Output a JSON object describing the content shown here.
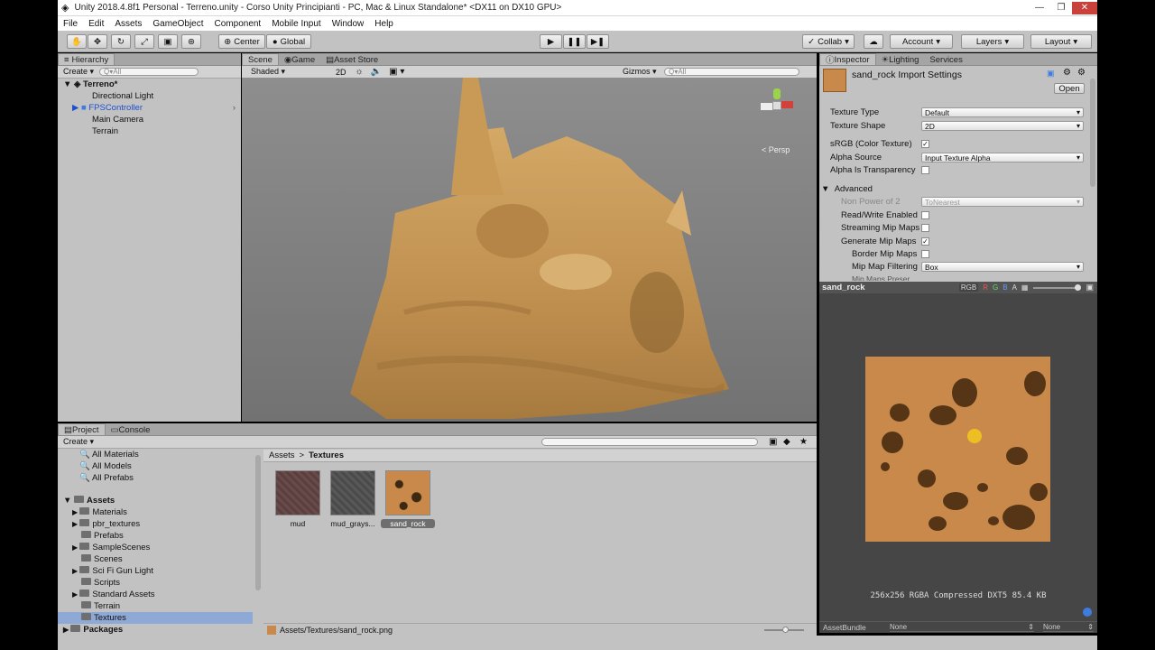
{
  "window": {
    "title": "Unity 2018.4.8f1 Personal - Terreno.unity - Corso Unity Principianti - PC, Mac & Linux Standalone* <DX11 on DX10 GPU>"
  },
  "menu": [
    "File",
    "Edit",
    "Assets",
    "GameObject",
    "Component",
    "Mobile Input",
    "Window",
    "Help"
  ],
  "toolbar": {
    "center_label": "Center",
    "global_label": "Global",
    "collab_label": "Collab",
    "account_label": "Account",
    "layers_label": "Layers",
    "layout_label": "Layout"
  },
  "hierarchy": {
    "tab": "Hierarchy",
    "create": "Create",
    "search_placeholder": "Q▾All",
    "scene": "Terreno*",
    "items": [
      "Directional Light",
      "FPSController",
      "Main Camera",
      "Terrain"
    ]
  },
  "scene_view": {
    "tabs": [
      "Scene",
      "Game",
      "Asset Store"
    ],
    "shading": "Shaded",
    "mode_2d": "2D",
    "gizmos": "Gizmos",
    "search_placeholder": "Q▾All",
    "persp": "< Persp"
  },
  "inspector": {
    "tabs": [
      "Inspector",
      "Lighting",
      "Services"
    ],
    "asset_title": "sand_rock Import Settings",
    "open_label": "Open",
    "texture_type_label": "Texture Type",
    "texture_type_value": "Default",
    "texture_shape_label": "Texture Shape",
    "texture_shape_value": "2D",
    "srgb_label": "sRGB (Color Texture)",
    "alpha_source_label": "Alpha Source",
    "alpha_source_value": "Input Texture Alpha",
    "alpha_transparency_label": "Alpha Is Transparency",
    "advanced_label": "Advanced",
    "npot_label": "Non Power of 2",
    "npot_value": "ToNearest",
    "readwrite_label": "Read/Write Enabled",
    "streaming_label": "Streaming Mip Maps",
    "genmip_label": "Generate Mip Maps",
    "bordermip_label": "Border Mip Maps",
    "mipfilter_label": "Mip Map Filtering",
    "mipfilter_value": "Box",
    "cutoff_label": "Mip Maps Preser..."
  },
  "preview": {
    "name": "sand_rock",
    "channels": [
      "RGB",
      "R",
      "G",
      "B",
      "A"
    ],
    "info": "256x256  RGBA Compressed DXT5   85.4 KB",
    "assetbundle_label": "AssetBundle",
    "assetbundle_value": "None",
    "variant_value": "None"
  },
  "project": {
    "tabs": [
      "Project",
      "Console"
    ],
    "create": "Create",
    "favorites": [
      "All Materials",
      "All Models",
      "All Prefabs"
    ],
    "assets_root": "Assets",
    "folders": [
      "Materials",
      "pbr_textures",
      "Prefabs",
      "SampleScenes",
      "Scenes",
      "Sci Fi Gun Light",
      "Scripts",
      "Standard Assets",
      "Terrain",
      "Textures"
    ],
    "packages": "Packages",
    "breadcrumb": [
      "Assets",
      "Textures"
    ],
    "assets": [
      "mud",
      "mud_grays...",
      "sand_rock"
    ],
    "path": "Assets/Textures/sand_rock.png"
  },
  "colors": {
    "accent_selected": "#3e7de0",
    "fps_blue": "#1f4fd0",
    "sand": "#c99a55"
  }
}
